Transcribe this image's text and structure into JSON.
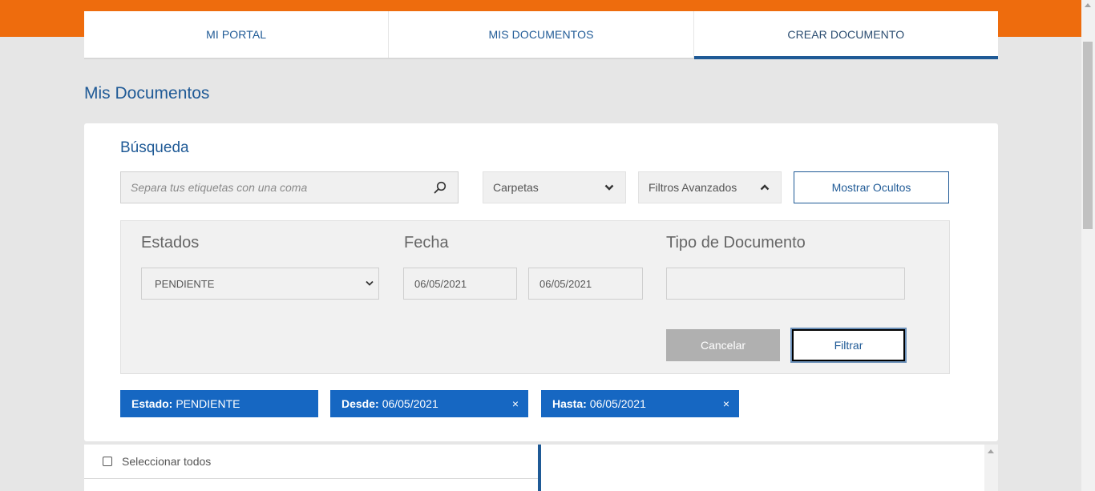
{
  "nav": {
    "tabs": [
      {
        "label": "MI PORTAL"
      },
      {
        "label": "MIS DOCUMENTOS"
      },
      {
        "label": "CREAR DOCUMENTO"
      }
    ],
    "active_tab_index": 2
  },
  "page": {
    "title": "Mis Documentos"
  },
  "search": {
    "title": "Búsqueda",
    "placeholder": "Separa tus etiquetas con una coma",
    "value": "",
    "carpetas_label": "Carpetas",
    "filtros_label": "Filtros Avanzados",
    "mostrar_ocultos_label": "Mostrar Ocultos"
  },
  "filters": {
    "estados_label": "Estados",
    "estado_value": "PENDIENTE",
    "fecha_label": "Fecha",
    "fecha_desde": "06/05/2021",
    "fecha_hasta": "06/05/2021",
    "tipo_label": "Tipo de Documento",
    "tipo_value": "",
    "cancel_label": "Cancelar",
    "filter_label": "Filtrar"
  },
  "chips": {
    "estado": {
      "key": "Estado:",
      "value": "PENDIENTE"
    },
    "desde": {
      "key": "Desde:",
      "value": "06/05/2021",
      "close": "×"
    },
    "hasta": {
      "key": "Hasta:",
      "value": "06/05/2021",
      "close": "×"
    }
  },
  "list": {
    "select_all_label": "Seleccionar todos"
  },
  "colors": {
    "brand_orange": "#ee6c0d",
    "primary_blue": "#1f5a96",
    "chip_blue": "#1667c2",
    "cancel_gray": "#b0b0b0"
  },
  "icons": {
    "search": "search-icon",
    "carpetas_chevron": "chevron-down-icon",
    "filtros_chevron": "chevron-up-icon",
    "select_chevron": "chevron-down-icon",
    "chip_close": "close-icon"
  }
}
